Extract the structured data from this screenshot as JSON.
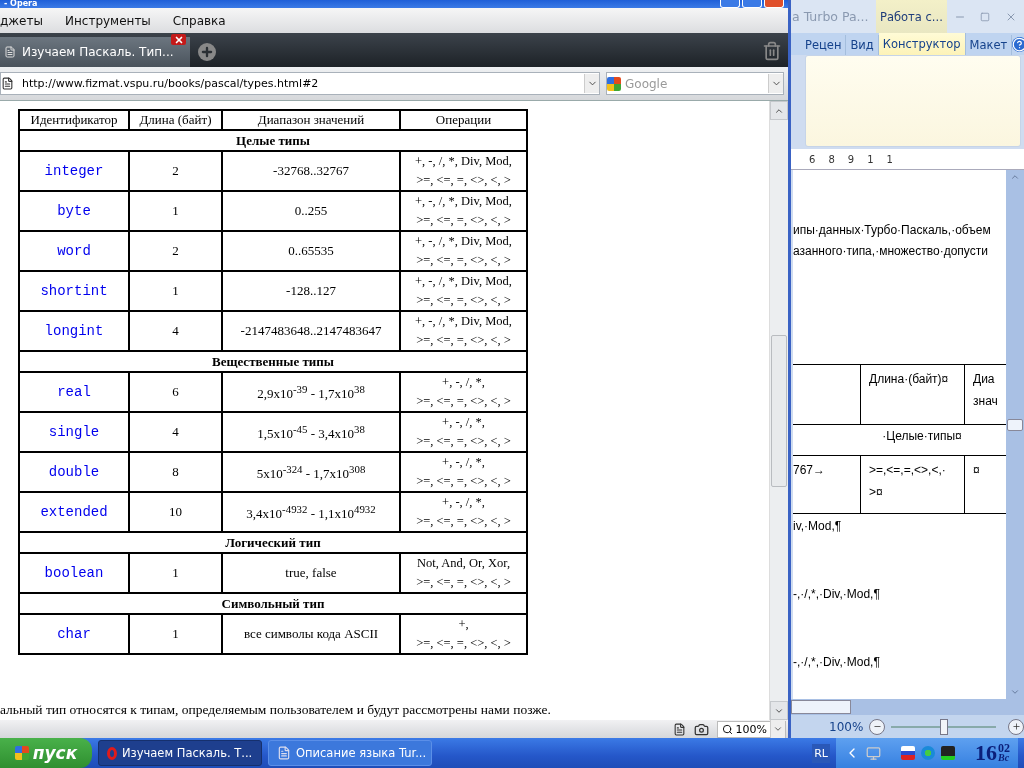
{
  "opera": {
    "title": "- Opera",
    "menu": [
      "джеты",
      "Инструменты",
      "Справка"
    ],
    "tabs": [
      {
        "label": "Изучаем Паскаль. Тип...",
        "selected": true
      }
    ],
    "address": {
      "value": "http://www.fizmat.vspu.ru/books/pascal/types.html#2"
    },
    "search": {
      "placeholder": "Google"
    },
    "table": {
      "columns": [
        "Идентификатор",
        "Длина (байт)",
        "Диапазон значений",
        "Операции"
      ],
      "sections": [
        {
          "title": "Целые типы",
          "rows": [
            {
              "identifier": "integer",
              "length": "2",
              "range": "-32768..32767",
              "operations": "+, -, /, *, Div, Mod,\n>=, <=, =, <>, <, >"
            },
            {
              "identifier": "byte",
              "length": "1",
              "range": "0..255",
              "operations": "+, -, /, *, Div, Mod,\n>=, <=, =, <>, <, >"
            },
            {
              "identifier": "word",
              "length": "2",
              "range": "0..65535",
              "operations": "+, -, /, *, Div, Mod,\n>=, <=, =, <>, <, >"
            },
            {
              "identifier": "shortint",
              "length": "1",
              "range": "-128..127",
              "operations": "+, -, /, *, Div, Mod,\n>=, <=, =, <>, <, >"
            },
            {
              "identifier": "longint",
              "length": "4",
              "range": "-2147483648..2147483647",
              "operations": "+, -, /, *, Div, Mod,\n>=, <=, =, <>, <, >"
            }
          ]
        },
        {
          "title": "Вещественные типы",
          "rows": [
            {
              "identifier": "real",
              "length": "6",
              "range": "2,9x10$^{-39}$ - 1,7x10$^{38}$",
              "operations": "+, -, /, *,\n>=, <=, =, <>, <, >"
            },
            {
              "identifier": "single",
              "length": "4",
              "range": "1,5x10$^{-45}$ - 3,4x10$^{38}$",
              "operations": "+, -, /, *,\n>=, <=, =, <>, <, >"
            },
            {
              "identifier": "double",
              "length": "8",
              "range": "5x10$^{-324}$ - 1,7x10$^{308}$",
              "operations": "+, -, /, *,\n>=, <=, =, <>, <, >"
            },
            {
              "identifier": "extended",
              "length": "10",
              "range": "3,4x10$^{-4932}$ - 1,1x10$^{4932}$",
              "operations": "+, -, /, *,\n>=, <=, =, <>, <, >"
            }
          ]
        },
        {
          "title": "Логический тип",
          "rows": [
            {
              "identifier": "boolean",
              "length": "1",
              "range": "true, false",
              "operations": "Not, And, Or, Xor,\n>=, <=, =, <>, <, >"
            }
          ]
        },
        {
          "title": "Символьный тип",
          "rows": [
            {
              "identifier": "char",
              "length": "1",
              "range": "все символы кода ASCII",
              "operations": "+,\n>=, <=, =, <>, <, >"
            }
          ]
        }
      ]
    },
    "footer_text": "альный тип относятся к типам, определяемым пользователем и будут рассмотрены нами позже.",
    "zoom": "100%"
  },
  "word": {
    "title": "a Turbo Pa...",
    "context_label": "Работа с...",
    "ribbon_tabs": [
      {
        "label": "Рецен",
        "selected": false
      },
      {
        "label": "Вид",
        "selected": false
      },
      {
        "label": "Конструктор",
        "selected": true
      },
      {
        "label": "Макет",
        "selected": false
      }
    ],
    "ruler_labels": [
      "6",
      "8",
      "9",
      "1",
      "1"
    ],
    "paragraphs": [
      "ипы·данных·Турбо·Паскаль,·объем",
      "азанного·типа,·множество·допусти"
    ],
    "table_rows": [
      {
        "kind": "cells",
        "cells": [
          "",
          "Длина·(байт)¤",
          "Диа\nзнач"
        ]
      },
      {
        "kind": "merged",
        "cells": [
          "·Целые·типы¤"
        ]
      },
      {
        "kind": "cells",
        "cells": [
          "767→",
          ">=,<=,=,<>,<,·\n>¤",
          "¤"
        ]
      }
    ],
    "after_lines": [
      "iv,·Mod,¶",
      "-,·/,*,·Div,·Mod,¶",
      "-,·/,*,·Div,·Mod,¶"
    ],
    "zoom": "100%",
    "zoom_slider": {
      "level": 0.5
    }
  },
  "taskbar": {
    "start": "пуск",
    "tasks": [
      {
        "label": "Изучаем Паскаль. Т...",
        "kind": "browser",
        "selected": true
      },
      {
        "label": "Описание языка Tur...",
        "kind": "document",
        "selected": false
      }
    ],
    "language": "RL",
    "clock": {
      "hours": "16",
      "minutes": "02",
      "day": "Вс"
    }
  }
}
